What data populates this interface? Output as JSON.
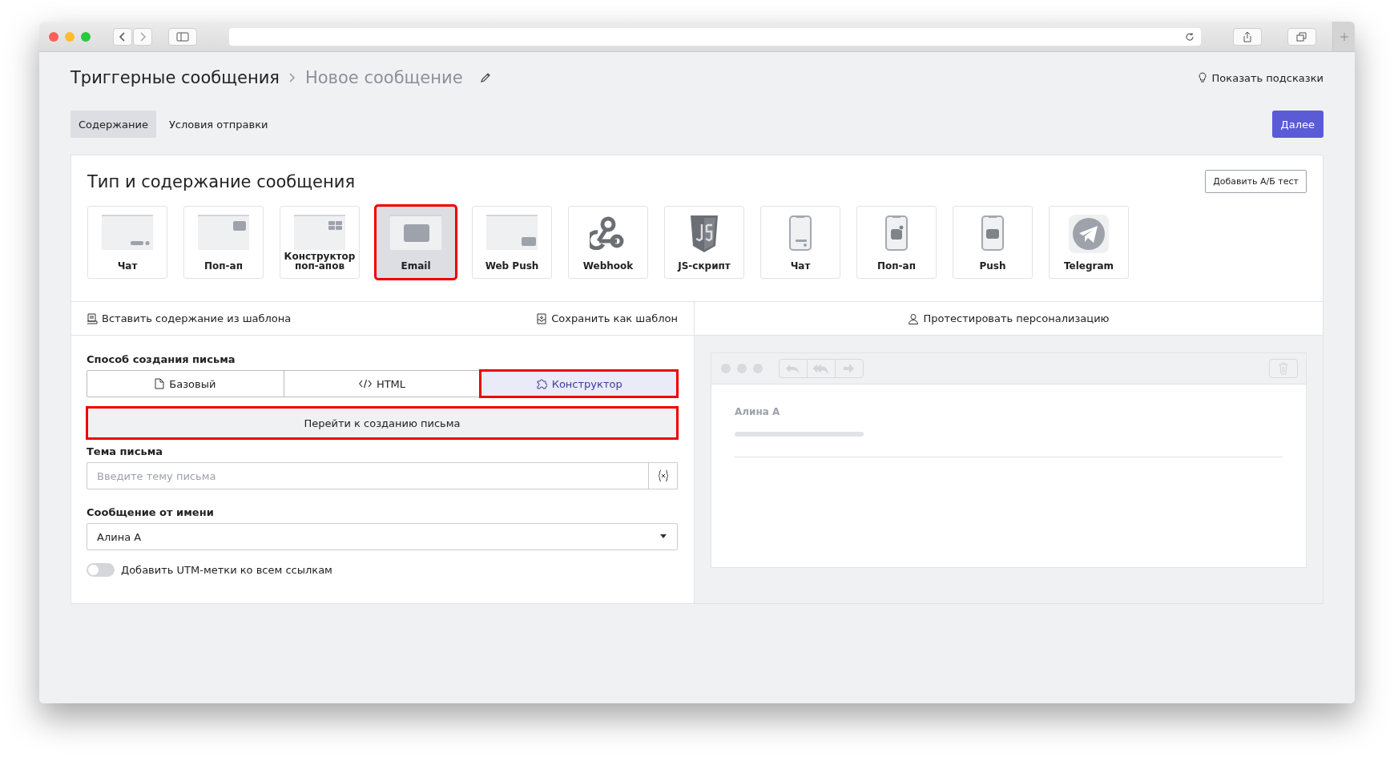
{
  "breadcrumb": {
    "parent": "Триггерные сообщения",
    "current": "Новое сообщение"
  },
  "hints_link": "Показать подсказки",
  "tabs": [
    {
      "label": "Содержание",
      "selected": true
    },
    {
      "label": "Условия отправки",
      "selected": false
    }
  ],
  "next_button": "Далее",
  "card": {
    "title": "Тип и содержание сообщения",
    "ab_button": "Добавить А/Б тест",
    "types": [
      {
        "kind": "web-chat",
        "label": "Чат",
        "selected": false,
        "highlighted": false
      },
      {
        "kind": "web-popup",
        "label": "Поп-ап",
        "selected": false,
        "highlighted": false
      },
      {
        "kind": "web-builder",
        "label": "Конструктор поп-апов",
        "selected": false,
        "highlighted": false
      },
      {
        "kind": "email",
        "label": "Email",
        "selected": true,
        "highlighted": true
      },
      {
        "kind": "web-push",
        "label": "Web Push",
        "selected": false,
        "highlighted": false
      },
      {
        "kind": "webhook",
        "label": "Webhook",
        "selected": false,
        "highlighted": false
      },
      {
        "kind": "js",
        "label": "JS-скрипт",
        "selected": false,
        "highlighted": false
      },
      {
        "kind": "mobile-chat",
        "label": "Чат",
        "selected": false,
        "highlighted": false
      },
      {
        "kind": "mobile-popup",
        "label": "Поп-ап",
        "selected": false,
        "highlighted": false
      },
      {
        "kind": "mobile-push",
        "label": "Push",
        "selected": false,
        "highlighted": false
      },
      {
        "kind": "telegram",
        "label": "Telegram",
        "selected": false,
        "highlighted": false
      }
    ]
  },
  "template_bar": {
    "insert": "Вставить содержание из шаблона",
    "save": "Сохранить как шаблон",
    "test": "Протестировать персонализацию"
  },
  "form": {
    "method_label": "Способ создания письма",
    "methods": [
      {
        "kind": "basic",
        "label": "Базовый",
        "selected": false,
        "highlighted": false
      },
      {
        "kind": "html",
        "label": "HTML",
        "selected": false,
        "highlighted": false
      },
      {
        "kind": "builder",
        "label": "Конструктор",
        "selected": true,
        "highlighted": true
      }
    ],
    "go_button": {
      "label": "Перейти к созданию письма",
      "highlighted": true
    },
    "subject_label": "Тема письма",
    "subject_placeholder": "Введите тему письма",
    "sender_label": "Сообщение от имени",
    "sender_value": "Алина А",
    "utm": {
      "label": "Добавить UTM-метки ко всем ссылкам",
      "on": false
    }
  },
  "preview": {
    "sender": "Алина А"
  }
}
